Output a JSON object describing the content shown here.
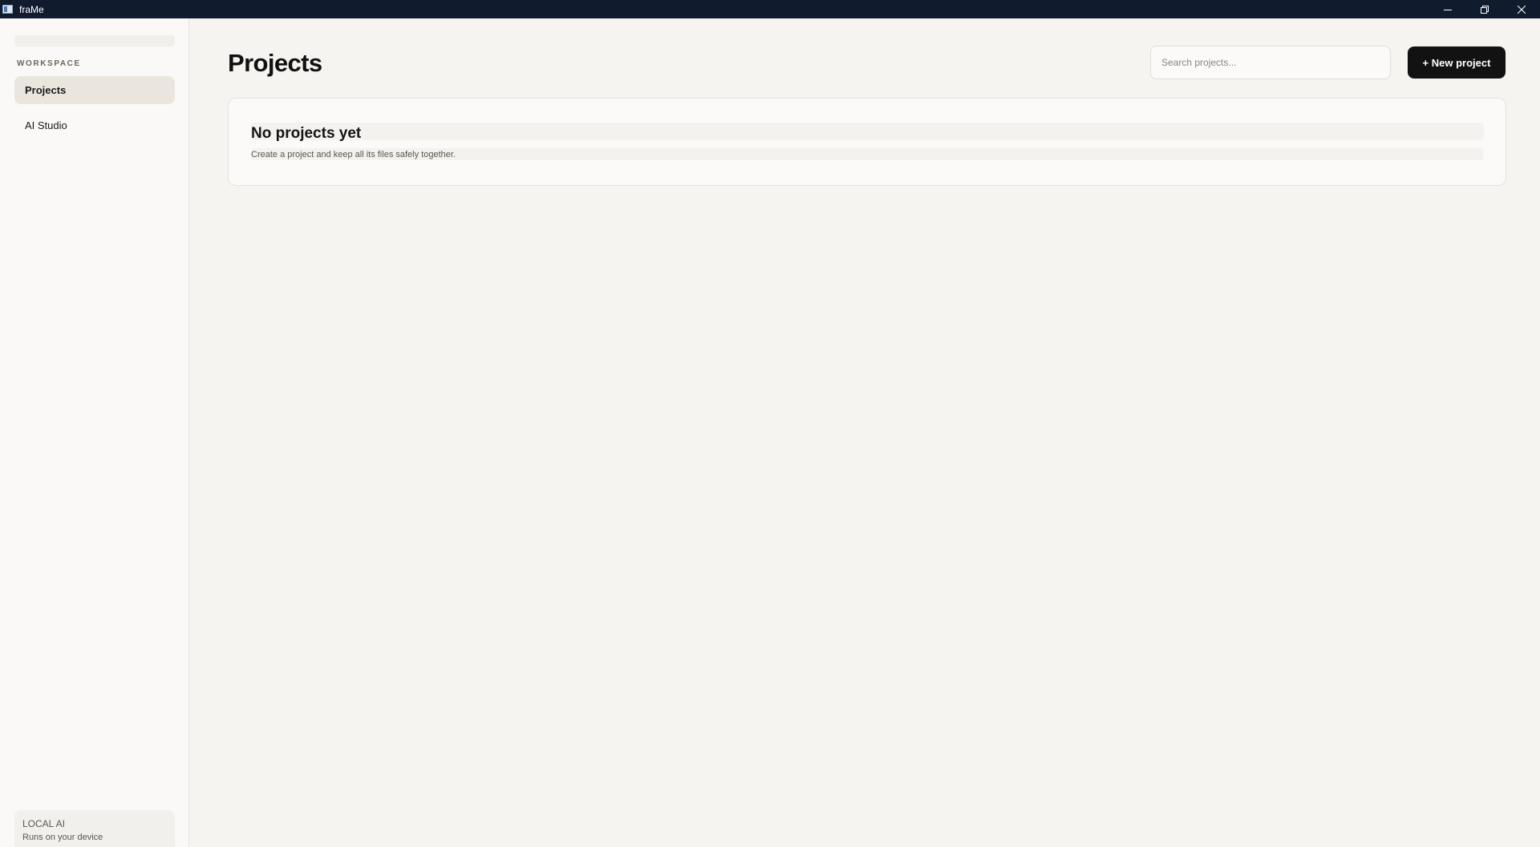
{
  "window": {
    "title": "fraMe",
    "controls": [
      "minimize-icon",
      "restore-icon",
      "close-icon"
    ]
  },
  "sidebar": {
    "section_label": "WORKSPACE",
    "items": [
      {
        "label": "Projects",
        "active": true
      },
      {
        "label": "AI Studio",
        "active": false
      }
    ],
    "footer": {
      "title": "LOCAL AI",
      "subtitle": "Runs on your device"
    }
  },
  "main": {
    "title": "Projects",
    "search": {
      "placeholder": "Search projects...",
      "value": ""
    },
    "new_project_label": "+ New project",
    "empty_state": {
      "title": "No projects yet",
      "subtitle": "Create a project and keep all its files safely together."
    }
  },
  "colors": {
    "titlebar": "#111b2e",
    "background": "#f5f4f0",
    "sidebar": "#faf9f7",
    "active_item": "#ebe6dd",
    "primary_button": "#121212"
  }
}
